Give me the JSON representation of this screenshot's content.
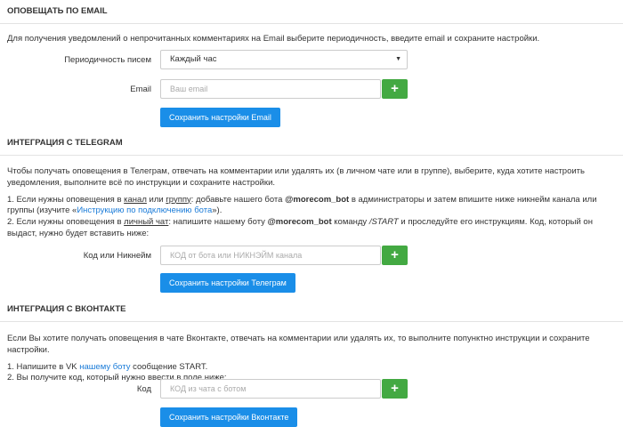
{
  "email": {
    "title": "ОПОВЕЩАТЬ ПО EMAIL",
    "description": "Для получения уведомлений о непрочитанных комментариях на Email выберите периодичность, введите email и сохраните настройки.",
    "frequency_label": "Периодичность писем",
    "frequency_value": "Каждый час",
    "email_label": "Email",
    "email_placeholder": "Ваш email",
    "save_label": "Сохранить настройки Email"
  },
  "telegram": {
    "title": "ИНТЕГРАЦИЯ С TELEGRAM",
    "description": "Чтобы получать оповещения в Телеграм, отвечать на комментарии или удалять их (в личном чате или в группе), выберите, куда хотите настроить уведомления, выполните всё по инструкции и сохраните настройки.",
    "step1": {
      "prefix": "1. Если нужны оповещения в ",
      "channel": "канал",
      "or": " или ",
      "group": "группу",
      "mid": ": добавьте нашего бота ",
      "bot": "@morecom_bot",
      "after": " в администраторы и затем впишите ниже никнейм канала или группы (изучите «",
      "link": "Инструкцию по подключению бота",
      "end": "»)."
    },
    "step2": {
      "prefix": "2. Если нужны оповещения в ",
      "chat": "личный чат",
      "mid": ": напишите нашему боту ",
      "bot": "@morecom_bot",
      "cmd_pre": " команду ",
      "cmd": "/START",
      "after": " и проследуйте его инструкциям. Код, который он выдаст, нужно будет вставить ниже:"
    },
    "code_label": "Код или Никнейм",
    "code_placeholder": "КОД от бота или НИКНЭЙМ канала",
    "save_label": "Сохранить настройки Телеграм"
  },
  "vk": {
    "title": "ИНТЕГРАЦИЯ С ВКОНТАКТЕ",
    "description": "Если Вы хотите получать оповещения в чате Вконтакте, отвечать на комментарии или удалять их, то выполните попунктно инструкции и сохраните настройки.",
    "step1_prefix": "1. Напишите в VK ",
    "step1_link": "нашему боту",
    "step1_suffix": " сообщение START.",
    "step2": "2. Вы получите код, который нужно ввести в поле ниже:",
    "code_label": "Код",
    "code_placeholder": "КОД из чата с ботом",
    "save_label": "Сохранить настройки Вконтакте"
  },
  "plus_symbol": "+",
  "caret_symbol": "▼",
  "colors": {
    "accent_green": "#43a942",
    "accent_blue": "#1a8ee8",
    "link": "#1a7bd8"
  }
}
